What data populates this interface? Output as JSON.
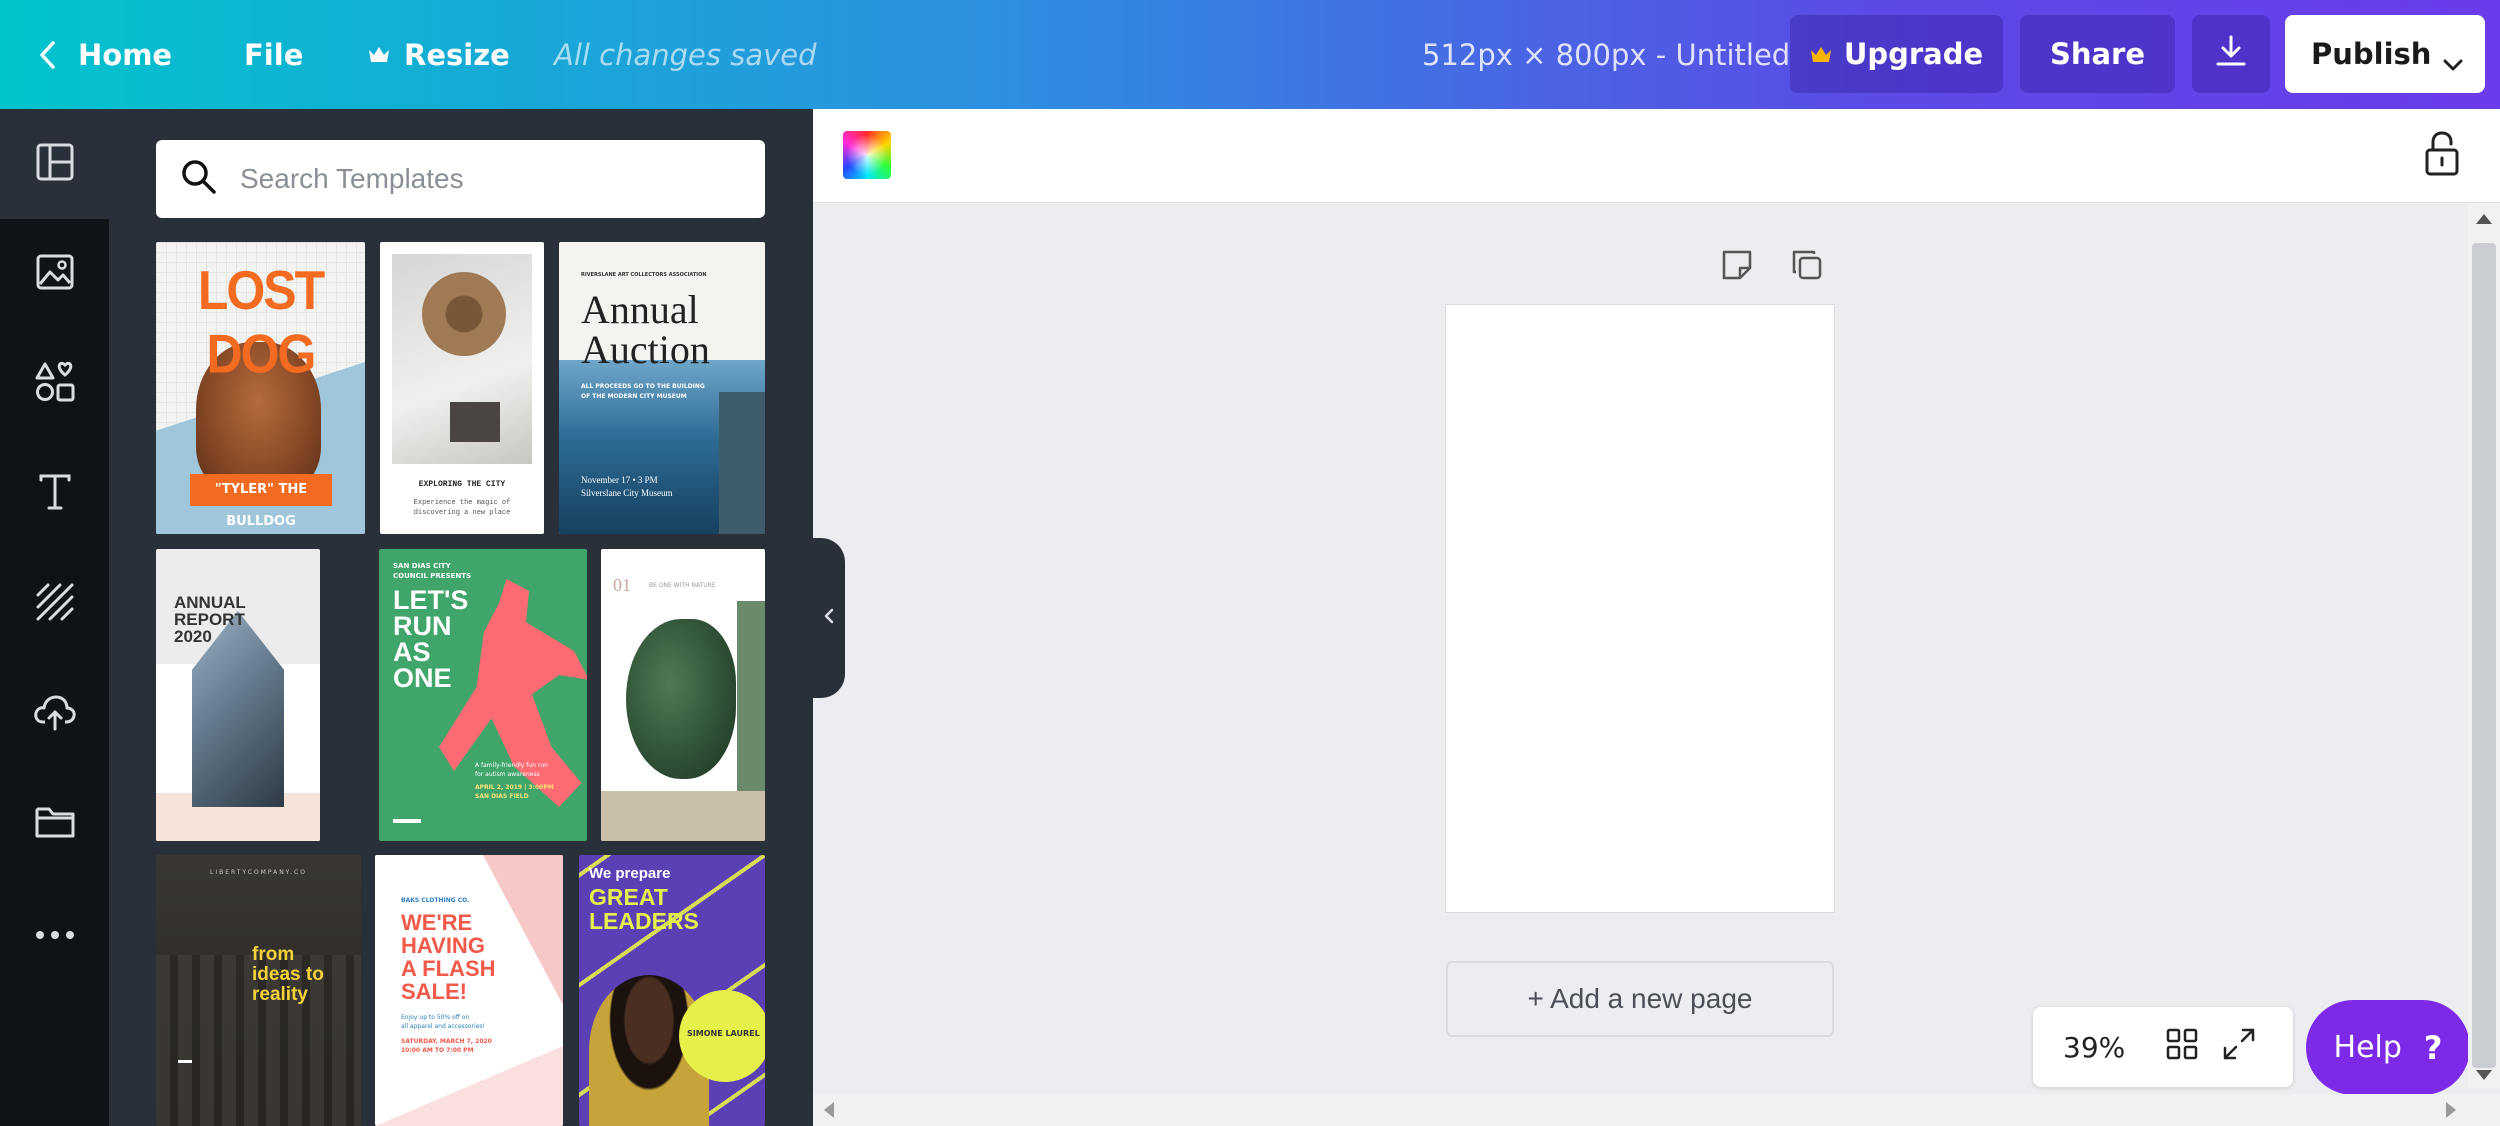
{
  "topbar": {
    "home_label": "Home",
    "file_label": "File",
    "resize_label": "Resize",
    "save_status": "All changes saved",
    "doc_title": "512px × 800px - Untitled",
    "upgrade_label": "Upgrade",
    "share_label": "Share",
    "publish_label": "Publish"
  },
  "sidebar": {
    "items": [
      {
        "icon": "templates-icon"
      },
      {
        "icon": "photos-icon"
      },
      {
        "icon": "elements-icon"
      },
      {
        "icon": "text-icon"
      },
      {
        "icon": "background-icon"
      },
      {
        "icon": "uploads-icon"
      },
      {
        "icon": "folder-icon"
      },
      {
        "icon": "more-icon"
      }
    ]
  },
  "search": {
    "placeholder": "Search Templates"
  },
  "templates": {
    "lost_dog": {
      "title": "LOST DOG",
      "caption": "\"TYLER\" THE BULLDOG"
    },
    "exploring": {
      "title": "EXPLORING THE CITY",
      "caption": "Experience the magic of\ndiscovering a new place"
    },
    "auction": {
      "org": "RIVERSLANE ART COLLECTORS ASSOCIATION",
      "title": "Annual\nAuction",
      "subtitle": "ALL PROCEEDS GO TO THE BUILDING\nOF THE MODERN CITY MUSEUM",
      "date": "November 17 • 3 PM\nSilverslane City Museum"
    },
    "annual_report": {
      "title": "ANNUAL\nREPORT\n2020"
    },
    "run": {
      "org": "SAN DIAS CITY\nCOUNCIL PRESENTS",
      "title": "LET'S\nRUN\nAS\nONE",
      "detail": "A family-friendly fun run\nfor autism awareness",
      "date": "APRIL 2, 2019 | 3:00PM\nSAN DIAS FIELD"
    },
    "nature": {
      "num": "01",
      "caption": "BE ONE WITH NATURE"
    },
    "liberty": {
      "org": "LIBERTYCOMPANY.CO",
      "title": "from\nideas to\nreality"
    },
    "flash_sale": {
      "org": "BAKS CLOTHING CO.",
      "title": "WE'RE\nHAVING\nA FLASH\nSALE!",
      "detail": "Enjoy up to 50% off on\nall apparel and accessories!",
      "date": "SATURDAY, MARCH 7, 2020\n10:00 AM TO 7:00 PM"
    },
    "leaders": {
      "pre": "We prepare",
      "title": "GREAT\nLEADERS",
      "name": "SIMONE LAUREL"
    }
  },
  "canvas": {
    "add_page_label": "+ Add a new page"
  },
  "zoom": {
    "level": "39%"
  },
  "help": {
    "label": "Help",
    "q": "?"
  }
}
